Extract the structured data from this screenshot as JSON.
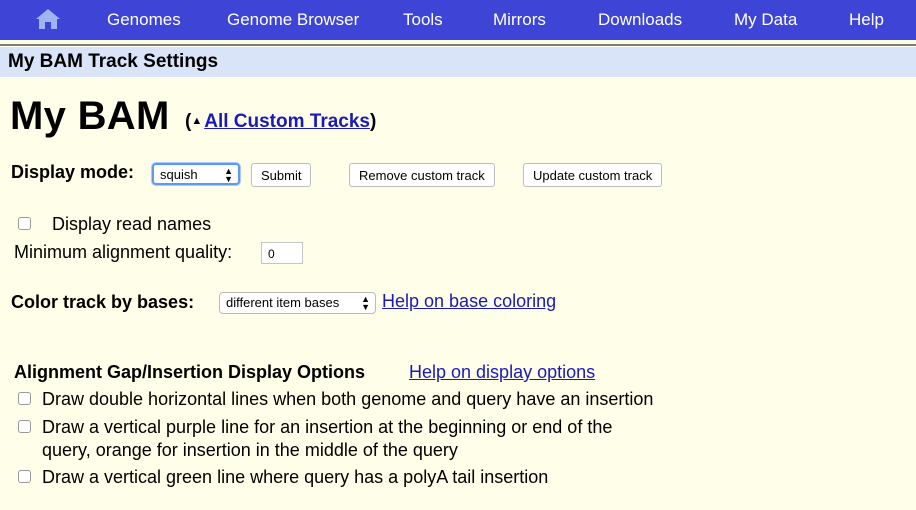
{
  "nav": {
    "home_icon": "home-icon",
    "items": [
      "Genomes",
      "Genome Browser",
      "Tools",
      "Mirrors",
      "Downloads",
      "My Data",
      "Help"
    ]
  },
  "settings_header": "My BAM Track Settings",
  "track_title": "My BAM",
  "breadcrumb": {
    "open": "(",
    "arrow": "▲",
    "link": "All Custom Tracks",
    "close": ")"
  },
  "display_mode": {
    "label": "Display mode:",
    "value": "squish",
    "submit": "Submit",
    "remove": "Remove custom track",
    "update": "Update custom track"
  },
  "read_names": {
    "label": "Display read names",
    "checked": false
  },
  "min_quality": {
    "label": "Minimum alignment quality:",
    "value": "0"
  },
  "color_bases": {
    "label": "Color track by bases:",
    "value": "different item bases",
    "help_link": "Help on base coloring"
  },
  "gap_options": {
    "title": "Alignment Gap/Insertion Display Options",
    "help_link": "Help on display options",
    "options": [
      {
        "label": "Draw double horizontal lines when both genome and query have an insertion",
        "checked": false
      },
      {
        "label": "Draw a vertical purple line for an insertion at the beginning or end of the",
        "label2": "query, orange for insertion in the middle of the query",
        "checked": false
      },
      {
        "label": "Draw a vertical green line where query has a polyA tail insertion",
        "checked": false
      }
    ]
  },
  "colors": {
    "nav_bg": "#3D44D6",
    "header_bg": "#D9E4F8",
    "page_bg": "#FFFEE8",
    "link": "#1A1AB8"
  }
}
